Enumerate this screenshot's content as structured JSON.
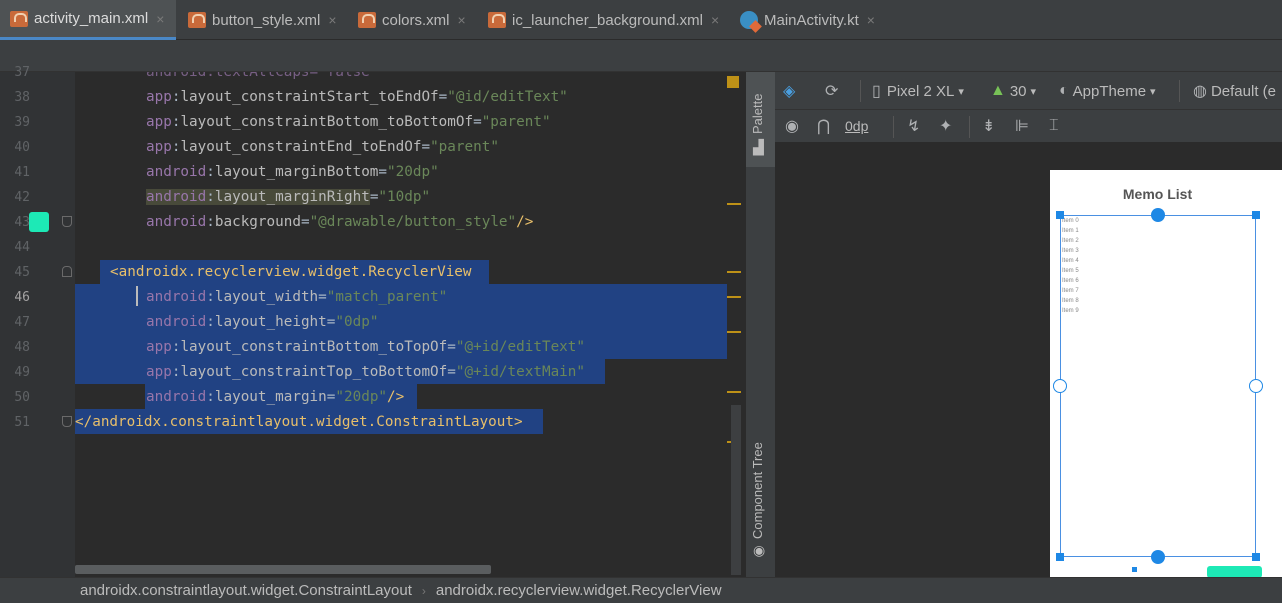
{
  "tabs": [
    {
      "label": "activity_main.xml",
      "icon": "xml-file-icon",
      "active": true
    },
    {
      "label": "button_style.xml",
      "icon": "xml-file-icon"
    },
    {
      "label": "colors.xml",
      "icon": "xml-file-icon"
    },
    {
      "label": "ic_launcher_background.xml",
      "icon": "xml-file-icon"
    },
    {
      "label": "MainActivity.kt",
      "icon": "kotlin-file-icon"
    }
  ],
  "close_glyph": "×",
  "line_numbers": [
    "37",
    "38",
    "39",
    "40",
    "41",
    "42",
    "43",
    "44",
    "45",
    "46",
    "47",
    "48",
    "49",
    "50",
    "51"
  ],
  "code": {
    "l37": "android:textAllCaps=\"false\"",
    "l38_ns": "app",
    ":": ":",
    "l38_attr": "layout_constraintStart_toEndOf",
    "l38_val": "\"@id/editText\"",
    "l39_ns": "app",
    "l39_attr": "layout_constraintBottom_toBottomOf",
    "l39_val": "\"parent\"",
    "l40_ns": "app",
    "l40_attr": "layout_constraintEnd_toEndOf",
    "l40_val": "\"parent\"",
    "l41_ns": "android",
    "l41_attr": "layout_marginBottom",
    "l41_val": "\"20dp\"",
    "l42_ns": "android",
    "l42_attr": "layout_marginRight",
    "l42_val": "\"10dp\"",
    "l43_ns": "android",
    "l43_attr": "background",
    "l43_val": "\"@drawable/button_style\"",
    "l43_end": "/>",
    "l45_tag": "<androidx.recyclerview.widget.RecyclerView",
    "l46_ns": "android",
    "l46_attr": "layout_width",
    "l46_val": "\"match_parent\"",
    "l47_ns": "android",
    "l47_attr": "layout_height",
    "l47_val": "\"0dp\"",
    "l48_ns": "app",
    "l48_attr": "layout_constraintBottom_toTopOf",
    "l48_val": "\"@+id/editText\"",
    "l49_ns": "app",
    "l49_attr": "layout_constraintTop_toBottomOf",
    "l49_val": "\"@+id/textMain\"",
    "l50_ns": "android",
    "l50_attr": "layout_margin",
    "l50_val": "\"20dp\"",
    "l50_end": "/>",
    "l51_tag": "</androidx.constraintlayout.widget.ConstraintLayout>"
  },
  "swatch_color": "#1de9b6",
  "side_panels": {
    "palette": "Palette",
    "component_tree": "Component Tree"
  },
  "design_toolbar": {
    "device": "Pixel 2 XL",
    "api": "30",
    "theme": "AppTheme",
    "locale": "Default (e",
    "margin": "0dp"
  },
  "preview": {
    "title": "Memo List",
    "items": [
      "Item 0",
      "Item 1",
      "Item 2",
      "Item 3",
      "Item 4",
      "Item 5",
      "Item 6",
      "Item 7",
      "Item 8",
      "Item 9"
    ]
  },
  "breadcrumb": [
    "androidx.constraintlayout.widget.ConstraintLayout",
    "androidx.recyclerview.widget.RecyclerView"
  ],
  "breadcrumb_sep": "›"
}
